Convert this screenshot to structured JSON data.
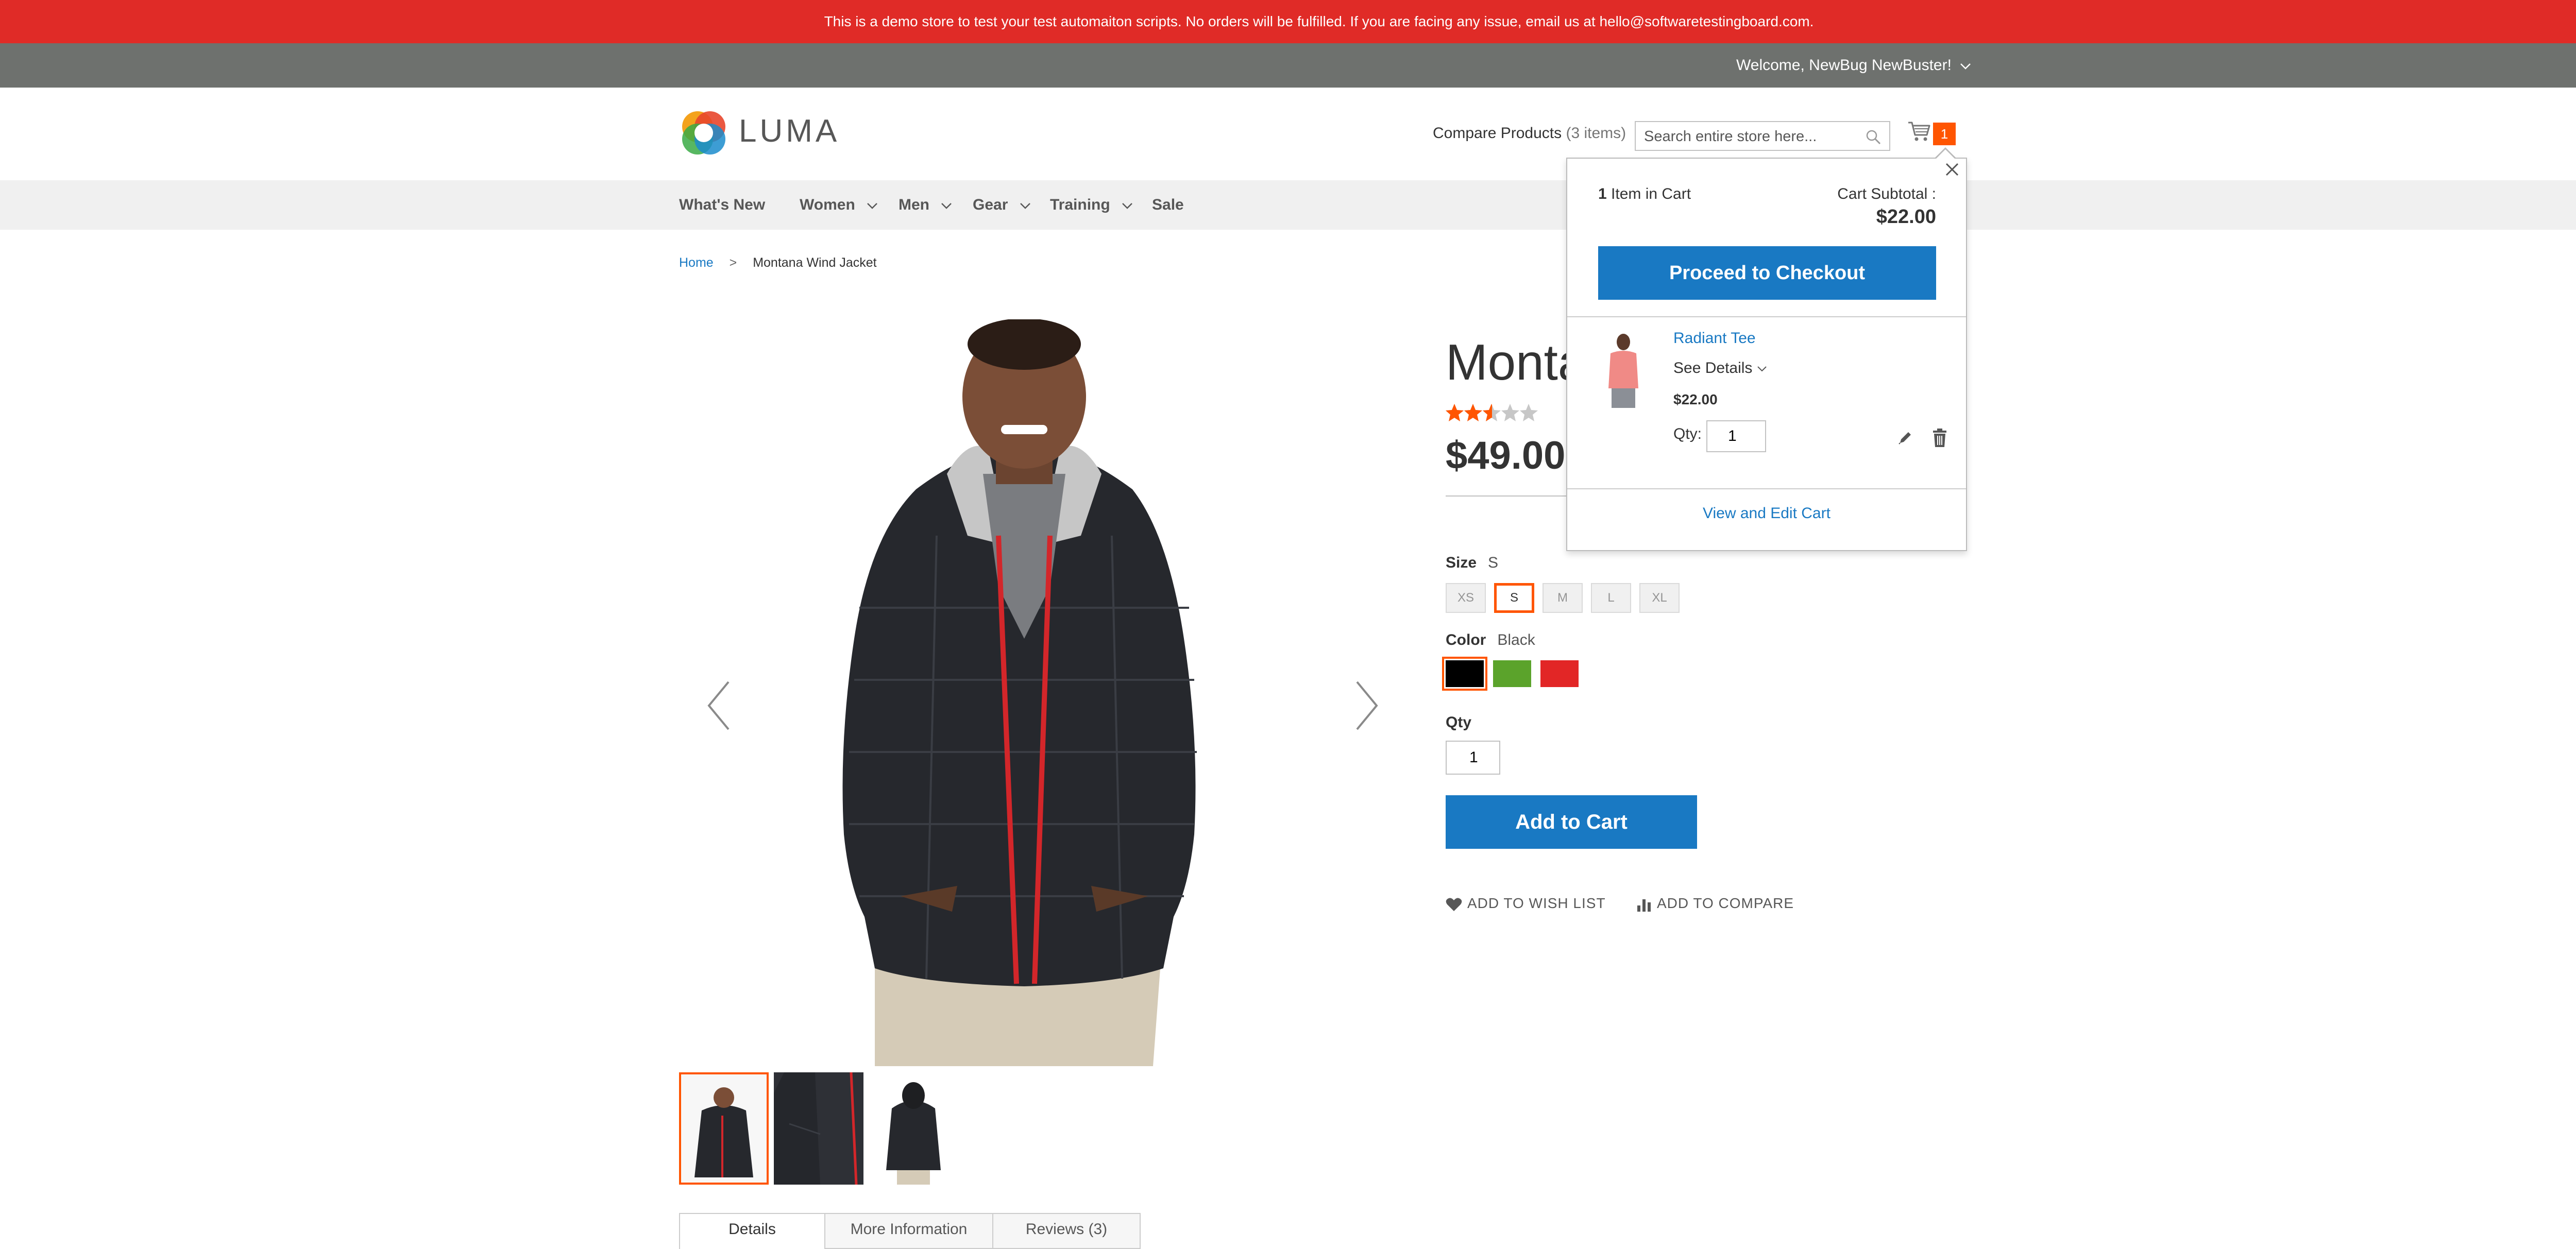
{
  "banner": {
    "text": "This is a demo store to test your test automaiton scripts. No orders will be fulfilled. If you are facing any issue, email us at hello@softwaretestingboard.com."
  },
  "top_bar": {
    "welcome": "Welcome, NewBug NewBuster!"
  },
  "header": {
    "logo_text": "LUMA",
    "compare_label": "Compare Products",
    "compare_count": "(3 items)",
    "search_placeholder": "Search entire store here...",
    "cart_count": "1"
  },
  "nav": {
    "items": [
      {
        "label": "What's New",
        "has_dropdown": false
      },
      {
        "label": "Women",
        "has_dropdown": true
      },
      {
        "label": "Men",
        "has_dropdown": true
      },
      {
        "label": "Gear",
        "has_dropdown": true
      },
      {
        "label": "Training",
        "has_dropdown": true
      },
      {
        "label": "Sale",
        "has_dropdown": false
      }
    ]
  },
  "breadcrumb": {
    "home": "Home",
    "separator": ">",
    "current": "Montana Wind Jacket"
  },
  "product": {
    "title_visible": "Monta",
    "rating_fraction": 0.5,
    "price": "$49.00",
    "size_label": "Size",
    "size_selected": "S",
    "sizes": [
      "XS",
      "S",
      "M",
      "L",
      "XL"
    ],
    "color_label": "Color",
    "color_selected": "Black",
    "colors": [
      "#000000",
      "#5ba32b",
      "#e22626"
    ],
    "qty_label": "Qty",
    "qty_value": "1",
    "add_to_cart": "Add to Cart",
    "wish_list": "ADD TO WISH LIST",
    "compare": "ADD TO COMPARE"
  },
  "tabs": [
    "Details",
    "More Information",
    "Reviews (3)"
  ],
  "minicart": {
    "count_number": "1",
    "count_text": "Item in Cart",
    "subtotal_label": "Cart Subtotal :",
    "subtotal": "$22.00",
    "checkout_label": "Proceed to Checkout",
    "item": {
      "name": "Radiant Tee",
      "see_details": "See Details",
      "price": "$22.00",
      "qty_label": "Qty:",
      "qty": "1"
    },
    "view_cart": "View and Edit Cart"
  },
  "colors": {
    "banner": "#e02b27",
    "top_bar": "#6e716e",
    "accent": "#1979c3",
    "highlight": "#ff5501"
  }
}
